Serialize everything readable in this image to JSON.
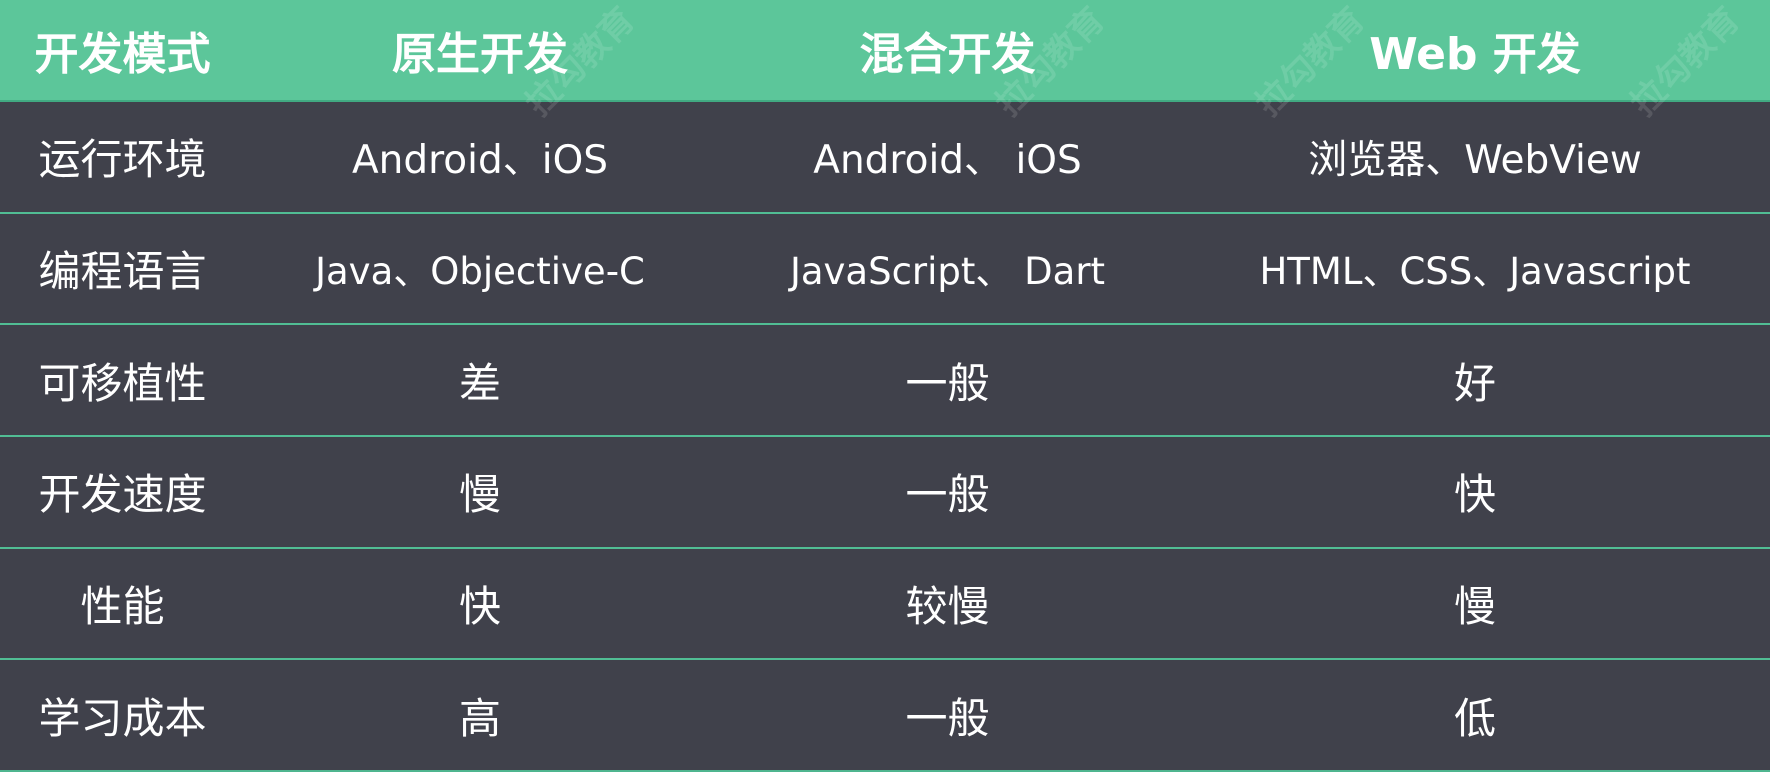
{
  "table": {
    "headers": [
      "开发模式",
      "原生开发",
      "混合开发",
      "Web 开发"
    ],
    "rows": [
      [
        "运行环境",
        "Android、iOS",
        "Android、 iOS",
        "浏览器、WebView"
      ],
      [
        "编程语言",
        "Java、Objective-C",
        "JavaScript、 Dart",
        "HTML、CSS、Javascript"
      ],
      [
        "可移植性",
        "差",
        "一般",
        "好"
      ],
      [
        "开发速度",
        "慢",
        "一般",
        "快"
      ],
      [
        "性能",
        "快",
        "较慢",
        "慢"
      ],
      [
        "学习成本",
        "高",
        "一般",
        "低"
      ]
    ]
  },
  "watermark": "拉勾教育",
  "colors": {
    "header_bg": "#5cc69a",
    "body_bg": "#40414b",
    "line": "#51bd94",
    "text": "#ffffff"
  }
}
